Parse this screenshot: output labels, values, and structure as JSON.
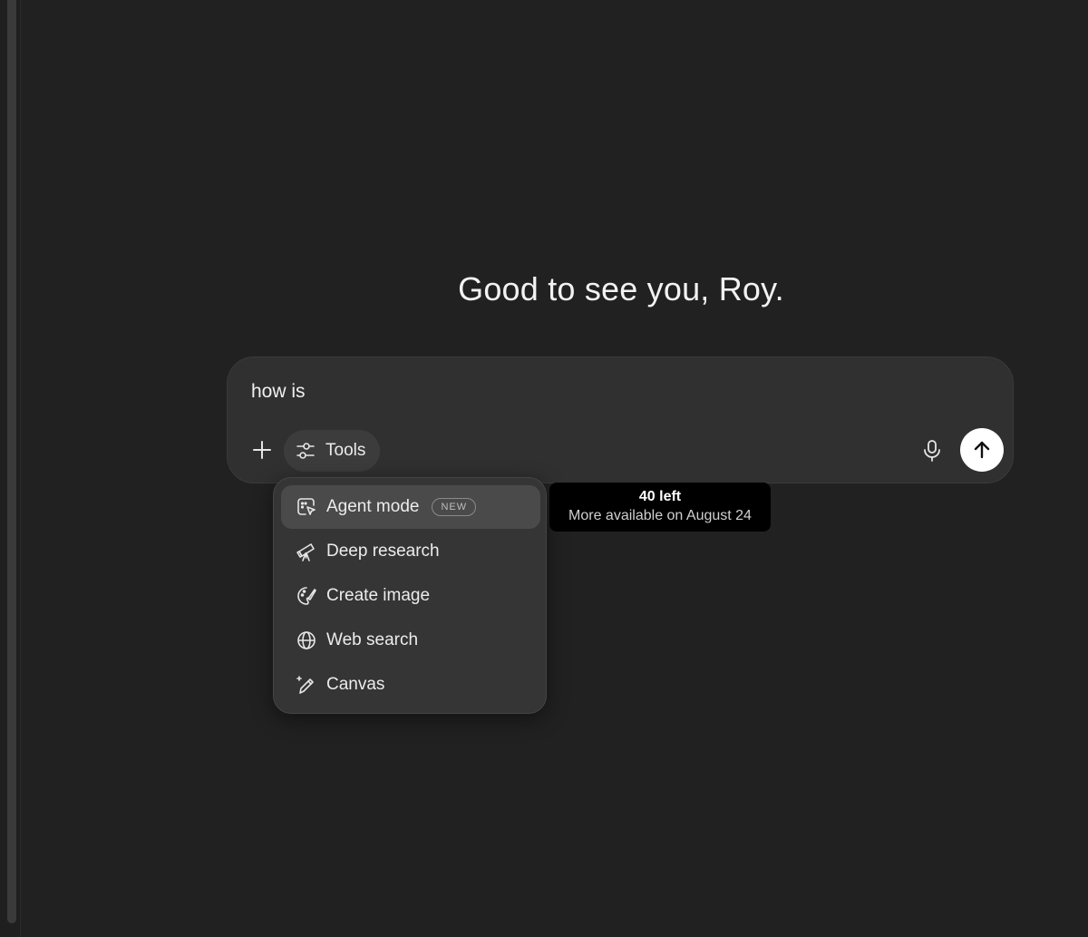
{
  "greeting": "Good to see you, Roy.",
  "composer": {
    "input_value": "how is",
    "tools_label": "Tools",
    "icons": {
      "plus": "plus-icon",
      "tools": "sliders-icon",
      "mic": "microphone-icon",
      "send": "arrow-up-icon"
    }
  },
  "tools_menu": {
    "items": [
      {
        "label": "Agent mode",
        "icon": "agent-cursor-icon",
        "badge": "NEW",
        "active": true
      },
      {
        "label": "Deep research",
        "icon": "telescope-icon"
      },
      {
        "label": "Create image",
        "icon": "palette-icon"
      },
      {
        "label": "Web search",
        "icon": "globe-icon"
      },
      {
        "label": "Canvas",
        "icon": "pencil-sparkle-icon"
      }
    ]
  },
  "tooltip": {
    "title": "40 left",
    "subtitle": "More available on August 24"
  },
  "colors": {
    "background": "#212121",
    "composer": "#303030",
    "menu": "#353535",
    "menu_active": "#4a4a4a",
    "tooltip": "#000000",
    "send_button": "#ffffff"
  }
}
